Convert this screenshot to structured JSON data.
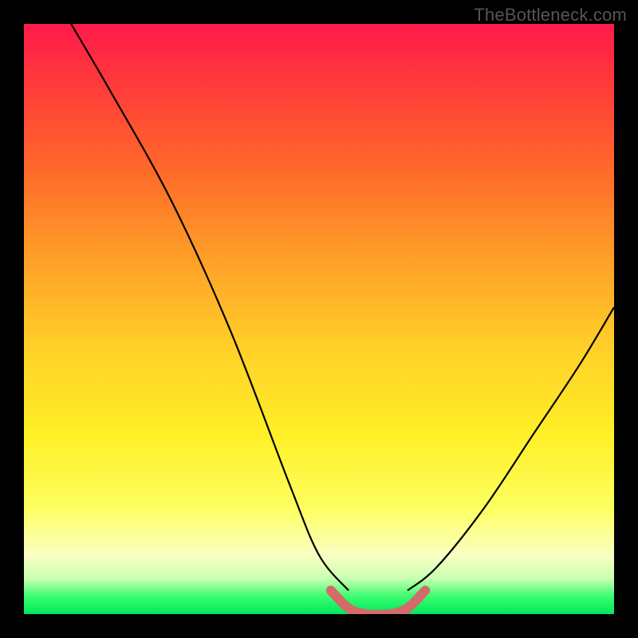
{
  "watermark": "TheBottleneck.com",
  "chart_data": {
    "type": "line",
    "title": "",
    "xlabel": "",
    "ylabel": "",
    "xlim": [
      0,
      100
    ],
    "ylim": [
      0,
      100
    ],
    "grid": false,
    "legend": false,
    "series": [
      {
        "name": "left-curve",
        "color": "#000000",
        "x": [
          8,
          15,
          25,
          35,
          45,
          50,
          55
        ],
        "y": [
          100,
          88,
          70,
          48,
          22,
          10,
          4
        ]
      },
      {
        "name": "right-curve",
        "color": "#000000",
        "x": [
          65,
          70,
          78,
          86,
          94,
          100
        ],
        "y": [
          4,
          8,
          18,
          30,
          42,
          52
        ]
      },
      {
        "name": "bottom-flat-highlight",
        "color": "#d46a6a",
        "thickness": 12,
        "x": [
          52,
          55,
          58,
          62,
          65,
          68
        ],
        "y": [
          4,
          1,
          0,
          0,
          1,
          4
        ]
      }
    ],
    "background_gradient": {
      "stops": [
        {
          "pos": 0.0,
          "color": "#ff1a4a"
        },
        {
          "pos": 0.1,
          "color": "#ff3a3a"
        },
        {
          "pos": 0.25,
          "color": "#ff6a2a"
        },
        {
          "pos": 0.4,
          "color": "#ffa028"
        },
        {
          "pos": 0.55,
          "color": "#ffd028"
        },
        {
          "pos": 0.7,
          "color": "#fff028"
        },
        {
          "pos": 0.82,
          "color": "#fdff60"
        },
        {
          "pos": 0.9,
          "color": "#faffc2"
        },
        {
          "pos": 0.94,
          "color": "#c8ffb0"
        },
        {
          "pos": 0.97,
          "color": "#3bfc70"
        },
        {
          "pos": 1.0,
          "color": "#00e85b"
        }
      ]
    },
    "annotations": [
      {
        "text": "TheBottleneck.com",
        "position": "top-right"
      }
    ]
  }
}
